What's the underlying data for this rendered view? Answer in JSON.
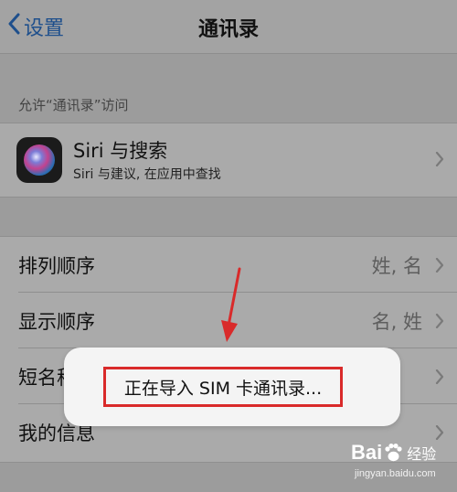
{
  "nav": {
    "back_label": "设置",
    "title": "通讯录"
  },
  "section": {
    "header": "允许“通讯录”访问"
  },
  "siri_row": {
    "title": "Siri 与搜索",
    "subtitle": "Siri 与建议, 在应用中查找"
  },
  "settings_rows": [
    {
      "label": "排列顺序",
      "value": "姓, 名"
    },
    {
      "label": "显示顺序",
      "value": "名, 姓"
    },
    {
      "label": "短名称",
      "value": ""
    },
    {
      "label": "我的信息",
      "value": ""
    }
  ],
  "hud": {
    "message": "正在导入 SIM 卡通讯录..."
  },
  "watermark": {
    "brand_left": "Bai",
    "brand_right": "经验",
    "url": "jingyan.baidu.com"
  },
  "colors": {
    "accent": "#1e4f8c",
    "highlight_box": "#d92a2a",
    "overlay_bg": "#9c9c9c"
  },
  "icons": {
    "back": "chevron-left-icon",
    "row_disclosure": "chevron-right-icon",
    "siri": "siri-icon",
    "annotation": "red-arrow-icon"
  }
}
